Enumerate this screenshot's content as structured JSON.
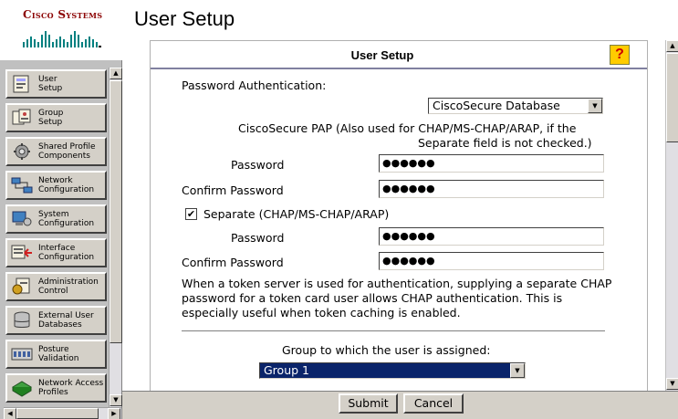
{
  "brand": {
    "logo_text": "Cisco Systems"
  },
  "header": {
    "title": "User Setup"
  },
  "sidebar": {
    "items": [
      {
        "label": "User\nSetup",
        "icon": "user-setup-icon"
      },
      {
        "label": "Group\nSetup",
        "icon": "group-setup-icon"
      },
      {
        "label": "Shared Profile\nComponents",
        "icon": "shared-profile-icon"
      },
      {
        "label": "Network\nConfiguration",
        "icon": "network-config-icon"
      },
      {
        "label": "System\nConfiguration",
        "icon": "system-config-icon"
      },
      {
        "label": "Interface\nConfiguration",
        "icon": "interface-config-icon"
      },
      {
        "label": "Administration\nControl",
        "icon": "administration-icon"
      },
      {
        "label": "External User\nDatabases",
        "icon": "database-icon"
      },
      {
        "label": "Posture\nValidation",
        "icon": "posture-icon"
      },
      {
        "label": "Network Access\nProfiles",
        "icon": "network-access-icon"
      }
    ]
  },
  "panel": {
    "title": "User Setup",
    "help_label": "?",
    "password_auth_label": "Password Authentication:",
    "auth_db_value": "CiscoSecure Database",
    "pap_note_line1": "CiscoSecure PAP (Also used for CHAP/MS-CHAP/ARAP, if the",
    "pap_note_line2": "Separate field is not checked.)",
    "password_label": "Password",
    "confirm_password_label": "Confirm Password",
    "password_mask": "●●●●●●",
    "separate_label": "Separate (CHAP/MS-CHAP/ARAP)",
    "separate_checked": "✔",
    "token_note": "When a token server is used for authentication, supplying a separate CHAP password for a token card user allows CHAP authentication. This is especially useful when token caching is enabled.",
    "group_label": "Group to which the user is assigned:",
    "group_value": "Group 1"
  },
  "footer": {
    "submit_label": "Submit",
    "cancel_label": "Cancel"
  },
  "colors": {
    "brand_red": "#8b0000",
    "help_yellow": "#ffcc00",
    "selection_blue": "#0a246a",
    "chrome_gray": "#d4d0c8"
  }
}
